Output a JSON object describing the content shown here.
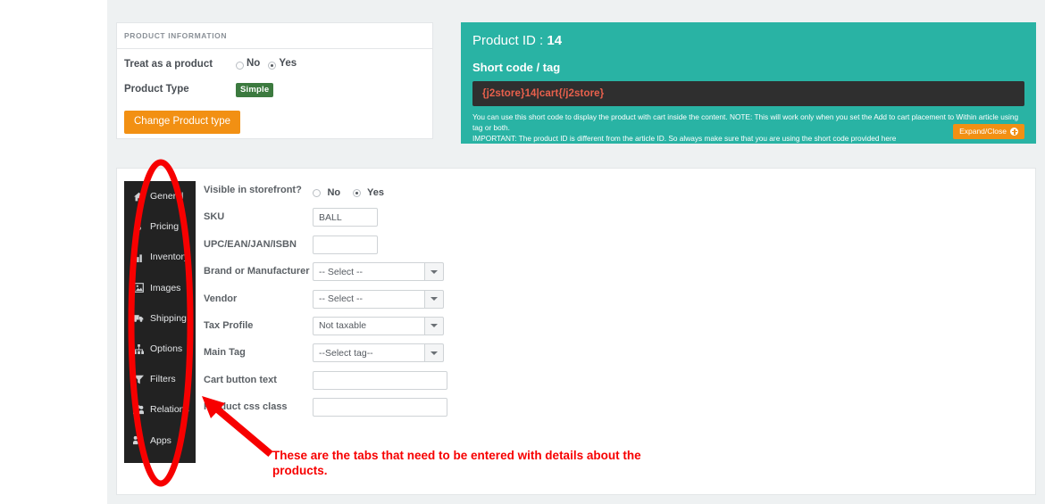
{
  "product_information": {
    "header": "PRODUCT INFORMATION",
    "rows": [
      {
        "label": "Treat as a product",
        "type": "radio",
        "options": [
          "No",
          "Yes"
        ],
        "selected": "Yes"
      },
      {
        "label": "Product Type",
        "type": "badge",
        "value": "Simple"
      }
    ],
    "change_type_button": "Change Product type"
  },
  "shortcode_panel": {
    "product_id_label": "Product ID :",
    "product_id_value": "14",
    "shortcode_title": "Short code / tag",
    "shortcode": "{j2store}14|cart{/j2store}",
    "help_line1": "You can use this short code to display the product with cart inside the content. NOTE: This will work only when you set the Add to cart placement to Within article using tag or both.",
    "help_line2": "IMPORTANT: The product ID is different from the article ID. So always make sure that you are using the short code provided here",
    "expand_button": "Expand/Close",
    "expand_icon": "plus-circle-icon",
    "bg_color": "#29b3a4",
    "code_bg_color": "#2f2f2f",
    "code_text_color": "#e8604c",
    "button_color": "#f29013"
  },
  "tabs": [
    {
      "label": "General",
      "icon": "home-icon"
    },
    {
      "label": "Pricing",
      "icon": "dollar-icon"
    },
    {
      "label": "Inventory",
      "icon": "bar-chart-icon"
    },
    {
      "label": "Images",
      "icon": "image-icon"
    },
    {
      "label": "Shipping",
      "icon": "truck-icon"
    },
    {
      "label": "Options",
      "icon": "sitemap-icon"
    },
    {
      "label": "Filters",
      "icon": "funnel-icon"
    },
    {
      "label": "Relations",
      "icon": "users-icon"
    },
    {
      "label": "Apps",
      "icon": "users-icon"
    }
  ],
  "general_form": {
    "visible_label": "Visible in storefront?",
    "visible_options": [
      "No",
      "Yes"
    ],
    "visible_selected": "Yes",
    "fields": [
      {
        "label": "SKU",
        "type": "text",
        "value": "BALL",
        "placeholder": ""
      },
      {
        "label": "UPC/EAN/JAN/ISBN",
        "type": "text",
        "value": "",
        "placeholder": ""
      },
      {
        "label": "Brand or Manufacturer",
        "type": "select",
        "value": "-- Select --"
      },
      {
        "label": "Vendor",
        "type": "select",
        "value": "-- Select --"
      },
      {
        "label": "Tax Profile",
        "type": "select",
        "value": "Not taxable"
      },
      {
        "label": "Main Tag",
        "type": "select",
        "value": "--Select tag--"
      },
      {
        "label": "Cart button text",
        "type": "text",
        "value": "",
        "placeholder": ""
      },
      {
        "label": "Product css class",
        "type": "text",
        "value": "",
        "placeholder": ""
      }
    ]
  },
  "annotation": {
    "text": "These are the tabs that need to be entered with details about the products.",
    "color": "#f70000"
  }
}
